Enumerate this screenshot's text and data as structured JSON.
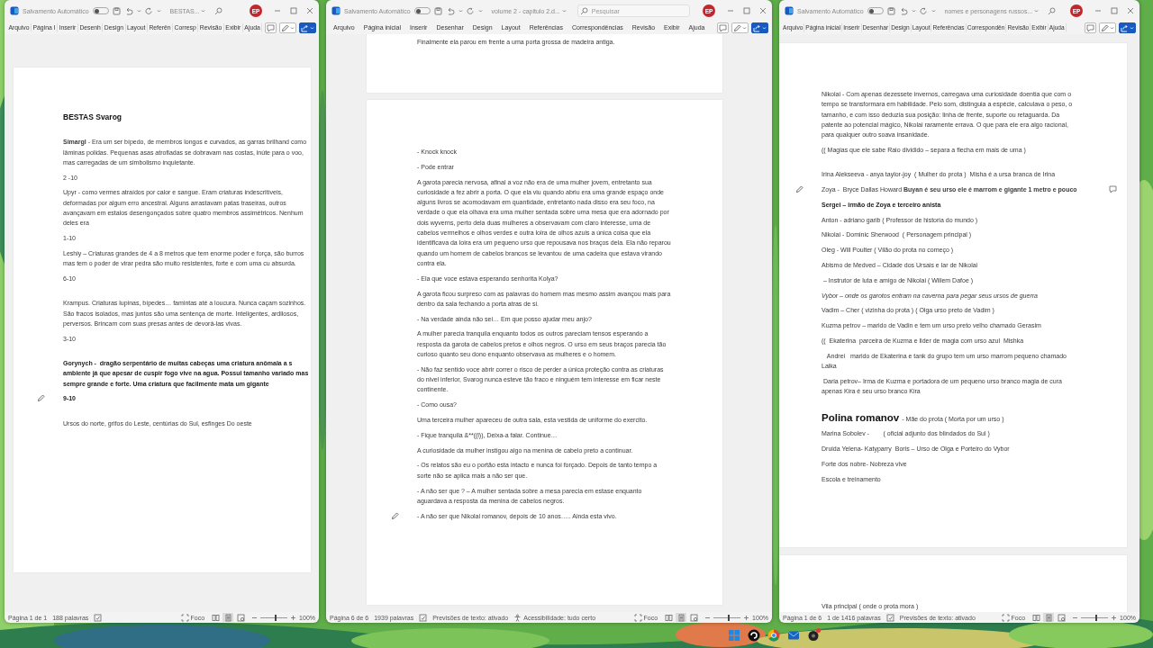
{
  "windows": [
    {
      "title_bar": {
        "autosave_label": "Salvamento Automático",
        "autosave_on": false,
        "document_title": "BESTAS...",
        "search": {
          "kind": "icon"
        },
        "account_initials": "EP"
      },
      "tabs": [
        {
          "label": "Arquivo",
          "selected": false
        },
        {
          "label": "Página I",
          "selected": false
        },
        {
          "label": "Inserir",
          "selected": false
        },
        {
          "label": "Desenh",
          "selected": false
        },
        {
          "label": "Design",
          "selected": false
        },
        {
          "label": "Layout",
          "selected": false
        },
        {
          "label": "Referên",
          "selected": false
        },
        {
          "label": "Corresp",
          "selected": false
        },
        {
          "label": "Revisão",
          "selected": false
        },
        {
          "label": "Exibir",
          "selected": false
        },
        {
          "label": "Ajuda",
          "selected": false
        }
      ],
      "pages": [
        {
          "sections": [
            {
              "paragraphs": [
                {
                  "kind": "title",
                  "text": "BESTAS Svarog"
                }
              ]
            },
            {
              "paragraphs": [
                {
                  "kind": "text",
                  "text": "**Simargl** - Era um ser bípedo, de membros longos e curvados, as garras brilhand como lâminas polidas. Pequenas asas atrofiadas se dobravam nas costas, inúte para o voo, mas carregadas de um simbolismo inquietante."
                },
                {
                  "kind": "text",
                  "text": "2 -10"
                },
                {
                  "kind": "text",
                  "text": "Upyr - como vermes atraídos por calor e sangue. Eram criaturas indescritíveis, deformadas por algum erro ancestral. Alguns arrastavam patas traseiras, outros avançavam em estalos desengonçados sobre quatro membros assimétricos. Nenhum deles era"
                },
                {
                  "kind": "text",
                  "text": "1-10"
                },
                {
                  "kind": "text",
                  "text": "Leshiy – Criaturas grandes de 4 a 8 metros que tem enorme poder e força, são burros mas tem o poder de virar pedra são muito resistentes, forte e com uma cu absurda."
                },
                {
                  "kind": "text",
                  "text": "6-10"
                }
              ]
            },
            {
              "paragraphs": [
                {
                  "kind": "text",
                  "text": "Krampus. Criaturas lupinas, bípedes… famintas até a loucura. Nunca caçam sozinhos. São fracos isolados, mas juntos são uma sentença de morte. Inteligentes, ardilosos, perversos. Brincam com suas presas antes de devorá-las vivas."
                },
                {
                  "kind": "text",
                  "text": "3-10"
                }
              ]
            },
            {
              "paragraphs": [
                {
                  "kind": "bold",
                  "text": "Gorynych -  dragão serpentário de muitas cabeças uma criatura anômala a s ambiente já que apesar de cuspir fogo vive na agua. Possui tamanho variado mas sempre grande e forte. Uma criatura que facilmente mata um gigante"
                },
                {
                  "kind": "bold",
                  "text": "9-10",
                  "marks": [
                    {
                      "kind": "edit"
                    }
                  ]
                }
              ]
            },
            {
              "paragraphs": [
                {
                  "kind": "text",
                  "text": "Ursos do norte, grifos do Leste, centúrias do Sul, esfinges Do oeste"
                }
              ]
            }
          ]
        }
      ],
      "status_bar": {
        "page": "Página 1 de 1",
        "words": "188 palavras",
        "focus": "Foco",
        "views": [
          {
            "kind": "read",
            "selected": false
          },
          {
            "kind": "print",
            "selected": true
          },
          {
            "kind": "web",
            "selected": false
          }
        ],
        "zoom": {
          "level": 0.55,
          "reading": "100%"
        }
      }
    },
    {
      "title_bar": {
        "autosave_label": "Salvamento Automático",
        "autosave_on": false,
        "document_title": "volume 2 - capitulo 2.d...",
        "search": {
          "kind": "field",
          "placeholder": "Pesquisar"
        },
        "account_initials": "EP"
      },
      "tabs": [
        {
          "label": "Arquivo",
          "selected": false
        },
        {
          "label": "Página inicial",
          "selected": false
        },
        {
          "label": "Inserir",
          "selected": false
        },
        {
          "label": "Desenhar",
          "selected": false
        },
        {
          "label": "Design",
          "selected": false
        },
        {
          "label": "Layout",
          "selected": false
        },
        {
          "label": "Referências",
          "selected": false
        },
        {
          "label": "Correspondências",
          "selected": false
        },
        {
          "label": "Revisão",
          "selected": false
        },
        {
          "label": "Exibir",
          "selected": false
        },
        {
          "label": "Ajuda",
          "selected": false
        }
      ],
      "pages": [
        {
          "sections": [
            {
              "paragraphs": [
                {
                  "kind": "text",
                  "text": "Finalmente ela parou em frente a uma porta grossa de madeira antiga."
                }
              ]
            }
          ]
        },
        {
          "sections": [
            {
              "paragraphs": [
                {
                  "kind": "text",
                  "text": "- Knock knock"
                },
                {
                  "kind": "text",
                  "text": "- Pode entrar"
                },
                {
                  "kind": "text",
                  "text": "A garota parecia nervosa, afinal a voz não era de uma mulher jovem, entretanto sua curiosidade a fez abrir a porta. O que ela viu quando abriu era uma grande espaço onde alguns livros se acomodavam em quantidade, entretanto nada disso era seu foco, na verdade o que ela olhava era uma mulher sentada sobre uma mesa que era adornado por dois wyverns, perto dela duas mulheres a observavam com claro interesse, uma de cabelos vermelhos e olhos verdes e outra loira de olhos azuis a única coisa que ela identificava da loira era um pequeno urso que repousava nos braços dela. Ela não reparou quando um homem de cabelos brancos se levantou de uma cadeira que estava virando contra ela."
                },
                {
                  "kind": "text",
                  "text": "- Ela que voce estava esperando senhorita Kolya?"
                },
                {
                  "kind": "text",
                  "text": "A garota ficou surpreso com as palavras do homem mas mesmo assim avançou mais para dentro da sala fechando a porta atras de si."
                },
                {
                  "kind": "text",
                  "text": "- Na verdade ainda não sei… Em que posso ajudar meu anjo?"
                },
                {
                  "kind": "text",
                  "text": "A mulher parecia tranquila enquanto todos os outros pareciam tensos esperando a resposta da garota de cabelos pretos e olhos negros. O urso em seus braços parecia tão curioso quanto seu dono enquanto observava as mulheres e o homem."
                },
                {
                  "kind": "text",
                  "text": "- Não faz sentido voce abrir correr o risco de perder a única proteção contra as criaturas do nivel inferior, Svarog nunca esteve tão fraco e ninguém tem interesse em ficar neste continente."
                },
                {
                  "kind": "text",
                  "text": "- Como ousa?"
                },
                {
                  "kind": "text",
                  "text": "Uma terceira mulher apareceu de outra sala, esta vestida de uniforme do exercito."
                },
                {
                  "kind": "text",
                  "text": "- Fique tranquila &**((l)), Deixa-a falar. Continue…"
                },
                {
                  "kind": "text",
                  "text": "A curiosidade da mulher instigou algo na menina de cabelo preto a continuar."
                },
                {
                  "kind": "text",
                  "text": "- Os relatos são eu o portão esta intacto e nunca foi forçado. Depois de tanto tempo a sorte não se aplica mais a não ser que."
                },
                {
                  "kind": "text",
                  "text": "- A não ser que ? – A mulher sentada sobre a mesa parecia em estase enquanto aguardava a resposta da menina de cabelos negros."
                },
                {
                  "kind": "text",
                  "text": "- A não ser que Nikolai romanov, depois de 10 anos….. Ainda esta vivo.",
                  "marks": [
                    {
                      "kind": "edit"
                    }
                  ]
                }
              ]
            }
          ]
        }
      ],
      "status_bar": {
        "page": "Página 6 de 6",
        "words": "1939 palavras",
        "extras": [
          {
            "kind": "predictions",
            "text": "Previsões de texto: ativado"
          },
          {
            "kind": "accessibility",
            "text": "Acessibilidade: tudo certo"
          }
        ],
        "focus": "Foco",
        "views": [
          {
            "kind": "read",
            "selected": false
          },
          {
            "kind": "print",
            "selected": true
          },
          {
            "kind": "web",
            "selected": false
          }
        ],
        "zoom": {
          "level": 0.55,
          "reading": "100%"
        }
      }
    },
    {
      "title_bar": {
        "autosave_label": "Salvamento Automático",
        "autosave_on": false,
        "document_title": "nomes e personagens russos...",
        "search": {
          "kind": "icon"
        },
        "account_initials": "EP"
      },
      "tabs": [
        {
          "label": "Arquivo",
          "selected": false
        },
        {
          "label": "Página inicial",
          "selected": false
        },
        {
          "label": "Inserir",
          "selected": false
        },
        {
          "label": "Desenhar",
          "selected": false
        },
        {
          "label": "Design",
          "selected": false
        },
        {
          "label": "Layout",
          "selected": false
        },
        {
          "label": "Referências",
          "selected": false
        },
        {
          "label": "Correspondên",
          "selected": false
        },
        {
          "label": "Revisão",
          "selected": false
        },
        {
          "label": "Exibir",
          "selected": false
        },
        {
          "label": "Ajuda",
          "selected": false
        }
      ],
      "pages": [
        {
          "sections": [
            {
              "paragraphs": [
                {
                  "kind": "text",
                  "text": "Nikolai - Com apenas dezessete invernos, carregava uma curiosidade doentia que com o tempo se transformara em habilidade. Pelo som, distinguia a espécie, calculava o peso, o tamanho, e com isso deduzia sua posição: linha de frente, suporte ou retaguarda. Da patente ao potencial mágico, Nikolai raramente errava. O que para ele era algo racional, para qualquer outro soava insanidade."
                },
                {
                  "kind": "text",
                  "text": "(( Magias que ele sabe Raio dividido – separa a flecha em mais de uma )"
                }
              ]
            },
            {
              "paragraphs": [
                {
                  "kind": "text",
                  "text": "Irina Alekseeva - anya taylor-joy  ( Mulher do prota )  Misha é a ursa branca de Irina"
                },
                {
                  "kind": "text",
                  "text": "Zoya -  Bryce Dallas Howard **Buyan é seu urso ele é marrom e gigante 1 metro e pouco**",
                  "marks": [
                    {
                      "kind": "edit"
                    },
                    {
                      "kind": "comment"
                    }
                  ]
                },
                {
                  "kind": "bold",
                  "text": "Sergei – irmão de Zoya e terceiro anista"
                },
                {
                  "kind": "text",
                  "text": "Anton - adriano garib ( Professor de historia do mundo )"
                },
                {
                  "kind": "text",
                  "text": "Nikolai - Dominic Sherwood  ( Personagem principal )"
                },
                {
                  "kind": "text",
                  "text": "Oleg - Will Poulter ( Vilão do prota no começo )"
                },
                {
                  "kind": "text",
                  "text": "Abismo de Medved – Cidade dos Ursais e lar de Nikolai"
                },
                {
                  "kind": "text",
                  "text": " – Instrutor de luta e amigo de Nikolai ( Willem Dafoe )"
                },
                {
                  "kind": "italic",
                  "text": "Vybor – onde os garotos entram na caverna para pegar seus ursos de guerra"
                },
                {
                  "kind": "text",
                  "text": "Vadim – Cher ( vizinha do prota ) ( Olga urso preto de Vadim )"
                },
                {
                  "kind": "text",
                  "text": "Kuzma petrov – marido de Vadin e tem um urso preto velho chamado Gerasim"
                },
                {
                  "kind": "text",
                  "text": "((  Ekaterina  parceira de Kuzma e lider de magia com urso azul  Mishka"
                },
                {
                  "kind": "text",
                  "text": "   Andrei   marido de Ekaterina e tank do grupo tem um urso marrom pequeno chamado Laika"
                },
                {
                  "kind": "text",
                  "text": " Daria petrov– Irma de Kuzma e portadora de um pequeno urso branco magia de cura apenas Kira é seu urso branco Kira"
                }
              ]
            },
            {
              "paragraphs": [
                {
                  "kind": "heading",
                  "title": "Polina romanov",
                  "text": "- Mãe do prota ( Morta por um urso )"
                },
                {
                  "kind": "text",
                  "text": "Marina Sobolev -        ( oficial adjunto dos blindados do Sul )"
                },
                {
                  "kind": "text",
                  "text": "Druida Yelena- Katyparry  Boris – Urso de Olga e Porteiro do Vybor"
                },
                {
                  "kind": "text",
                  "text": "Forte dos nobre- Nobreza vive"
                },
                {
                  "kind": "text",
                  "text": "Escola e treinamento"
                }
              ]
            }
          ]
        },
        {
          "sections": [
            {
              "paragraphs": [
                {
                  "kind": "text",
                  "text": "Vila principal ( onde o prota mora )"
                }
              ]
            }
          ]
        }
      ],
      "status_bar": {
        "page": "Página 1 de 6",
        "words": "1 de 1416 palavras",
        "extras": [
          {
            "kind": "predictions",
            "text": "Previsões de texto: ativado"
          }
        ],
        "focus": "Foco",
        "views": [
          {
            "kind": "read",
            "selected": false
          },
          {
            "kind": "print",
            "selected": true
          },
          {
            "kind": "web",
            "selected": false
          }
        ],
        "zoom": {
          "level": 0.55,
          "reading": "100%"
        }
      }
    }
  ],
  "taskbar": {
    "apps": [
      {
        "kind": "start",
        "badge": false
      },
      {
        "kind": "swirl",
        "badge": false
      },
      {
        "kind": "browser",
        "badge": false
      },
      {
        "kind": "mail",
        "badge": false
      },
      {
        "kind": "game",
        "badge": true
      }
    ]
  }
}
